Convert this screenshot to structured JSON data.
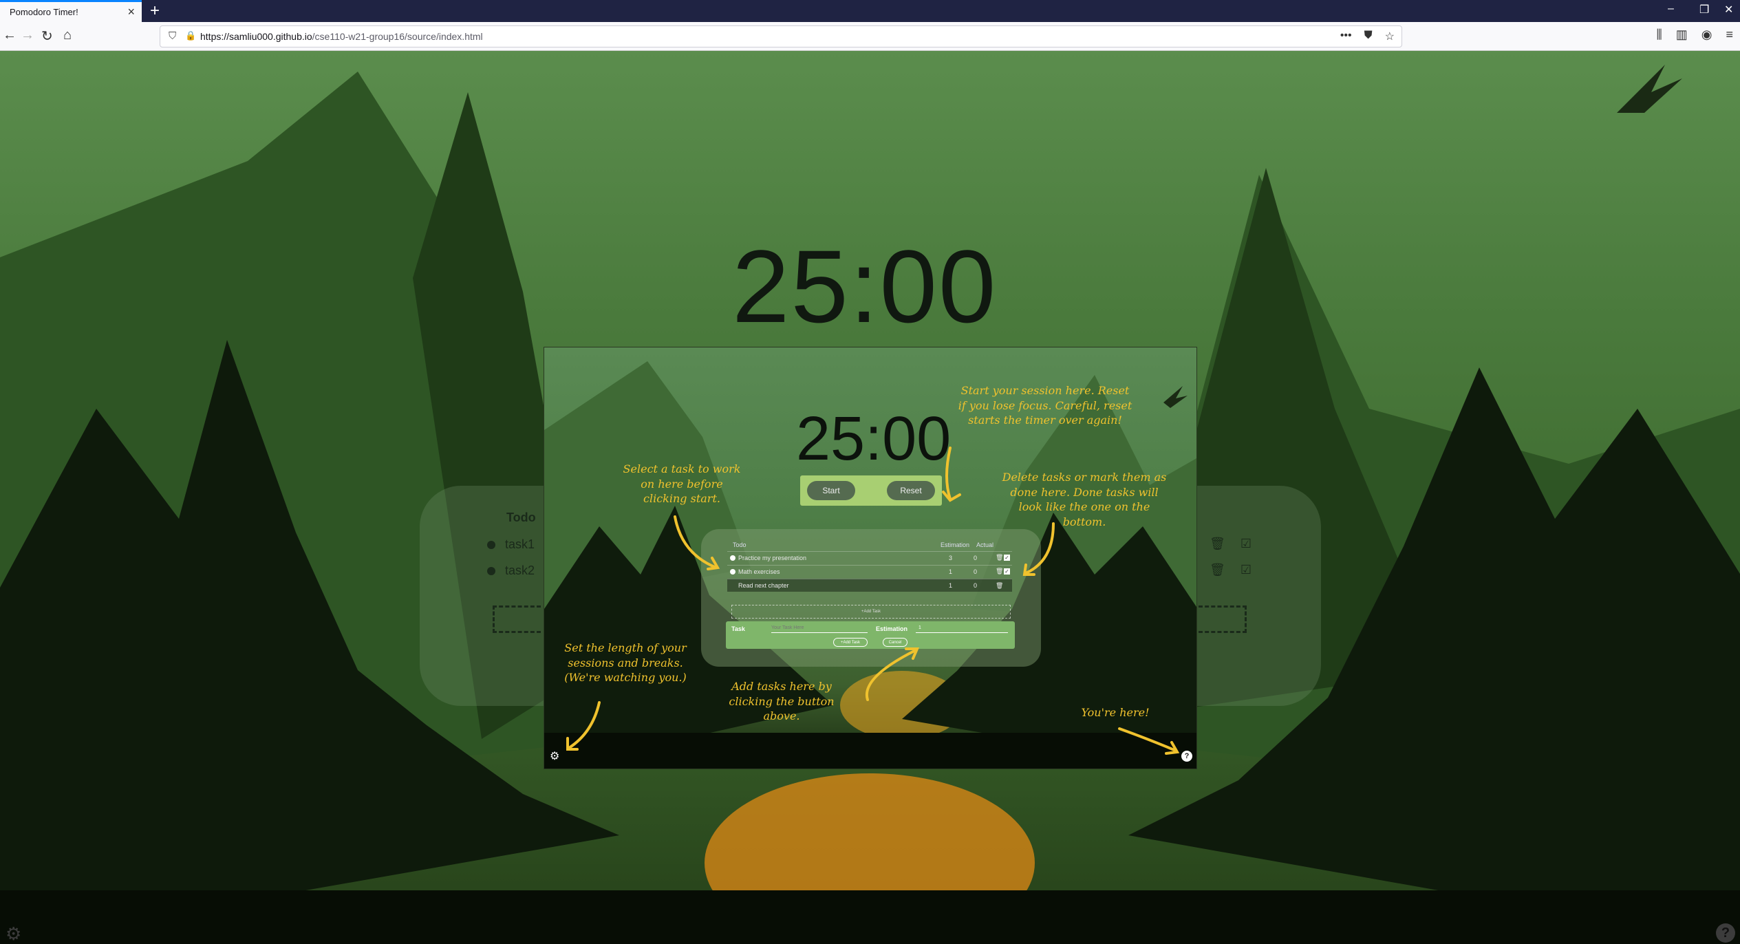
{
  "browser": {
    "tab_title": "Pomodoro Timer!",
    "tab_close": "×",
    "new_tab": "+",
    "url_host": "https://samliu000.github.io",
    "url_path": "/cse110-w21-group16/source/index.html",
    "win_min": "–",
    "win_restore": "❐",
    "win_close": "✕"
  },
  "background": {
    "timer": "25:00",
    "todo_header": "Todo",
    "tasks": [
      {
        "name": "task1"
      },
      {
        "name": "task2"
      }
    ]
  },
  "overlay": {
    "timer": "25:00",
    "start_label": "Start",
    "reset_label": "Reset",
    "table": {
      "col_todo": "Todo",
      "col_estimation": "Estimation",
      "col_actual": "Actual",
      "rows": [
        {
          "name": "Practice my presentation",
          "estimation": "3",
          "actual": "0"
        },
        {
          "name": "Math exercises",
          "estimation": "1",
          "actual": "0"
        },
        {
          "name": "Read next chapter",
          "estimation": "1",
          "actual": "0"
        }
      ]
    },
    "add_task_label": "+Add Task",
    "form": {
      "task_label": "Task",
      "task_placeholder": "Your Task Here",
      "estimation_label": "Estimation",
      "estimation_value": "1",
      "add_button": "+Add Task",
      "cancel_button": "Cancel"
    },
    "annotations": {
      "start_reset": "Start your session here. Reset if you lose focus. Careful, reset starts the timer over again!",
      "select_task": "Select a task to work on here before clicking start.",
      "delete_done": "Delete tasks or mark them as done here. Done tasks will look like the one on the bottom.",
      "settings": "Set the length of your sessions and breaks. (We're watching you.)",
      "add_tasks": "Add tasks here by clicking the button above.",
      "youre_here": "You're here!"
    }
  },
  "icons": {
    "settings": "gear-icon",
    "help": "question-icon",
    "trash": "trash-icon",
    "check": "checkbox-icon"
  },
  "colors": {
    "accent": "#f0c22e",
    "timer_controls_bg": "#a8cf72",
    "button_bg": "#556b50",
    "form_bg": "#7fb66a"
  }
}
